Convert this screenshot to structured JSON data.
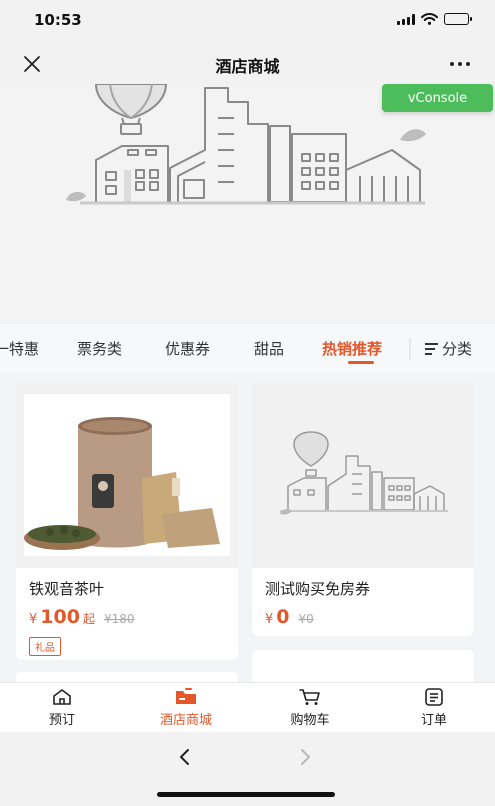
{
  "status_bar": {
    "time": "10:53"
  },
  "nav": {
    "title": "酒店商城"
  },
  "debug": {
    "vconsole_label": "vConsole"
  },
  "tabs": {
    "items": [
      {
        "label": "一特惠"
      },
      {
        "label": "票务类"
      },
      {
        "label": "优惠券"
      },
      {
        "label": "甜品"
      },
      {
        "label": "热销推荐"
      }
    ],
    "active_index": 4,
    "category_label": "分类"
  },
  "products": [
    {
      "name": "铁观音茶叶",
      "currency": "¥",
      "price": "100",
      "price_suffix": "起",
      "original_price": "¥180",
      "tag": "礼品",
      "image": "tea-canister-photo"
    },
    {
      "name": "测试购买免房券",
      "currency": "¥",
      "price": "0",
      "price_suffix": "",
      "original_price": "¥0",
      "tag": "",
      "image": "placeholder-city-illustration"
    }
  ],
  "tabbar": {
    "items": [
      {
        "label": "预订",
        "icon": "home-icon"
      },
      {
        "label": "酒店商城",
        "icon": "store-icon"
      },
      {
        "label": "购物车",
        "icon": "cart-icon"
      },
      {
        "label": "订单",
        "icon": "order-icon"
      }
    ],
    "active_index": 1
  },
  "colors": {
    "accent": "#e3572a",
    "vconsole": "#4dbd5c"
  }
}
